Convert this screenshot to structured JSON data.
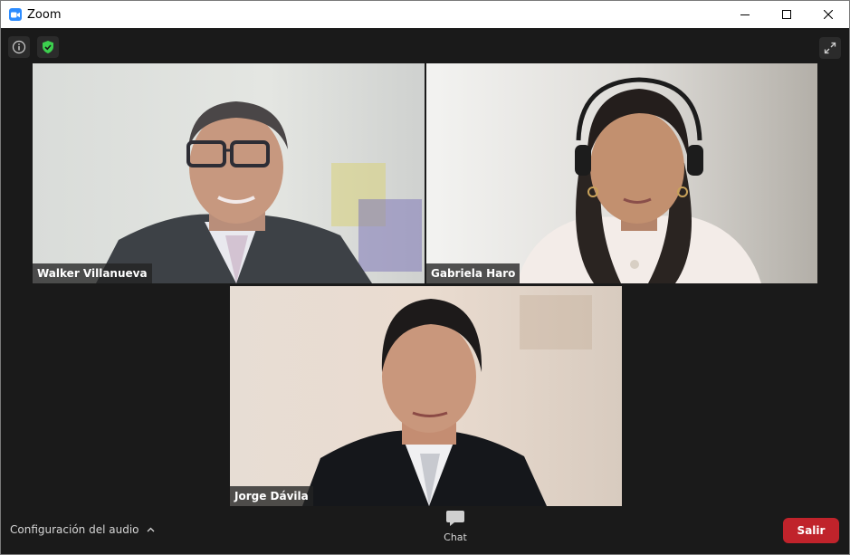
{
  "window": {
    "title": "Zoom",
    "app_icon": "zoom-camera-icon"
  },
  "window_controls": {
    "minimize": "minimize-icon",
    "maximize": "maximize-icon",
    "close": "close-icon"
  },
  "top_toolbar": {
    "info_icon": "info-icon",
    "security_icon": "shield-check-icon",
    "security_color": "#3ccf4e",
    "fullscreen_icon": "fullscreen-icon"
  },
  "participants": [
    {
      "name": "Walker Villanueva"
    },
    {
      "name": "Gabriela Haro"
    },
    {
      "name": "Jorge Dávila"
    }
  ],
  "bottom_bar": {
    "audio_settings_label": "Configuración del audio",
    "chat_label": "Chat",
    "chat_icon": "chat-bubble-icon",
    "leave_label": "Salir",
    "leave_color": "#c0232b"
  }
}
